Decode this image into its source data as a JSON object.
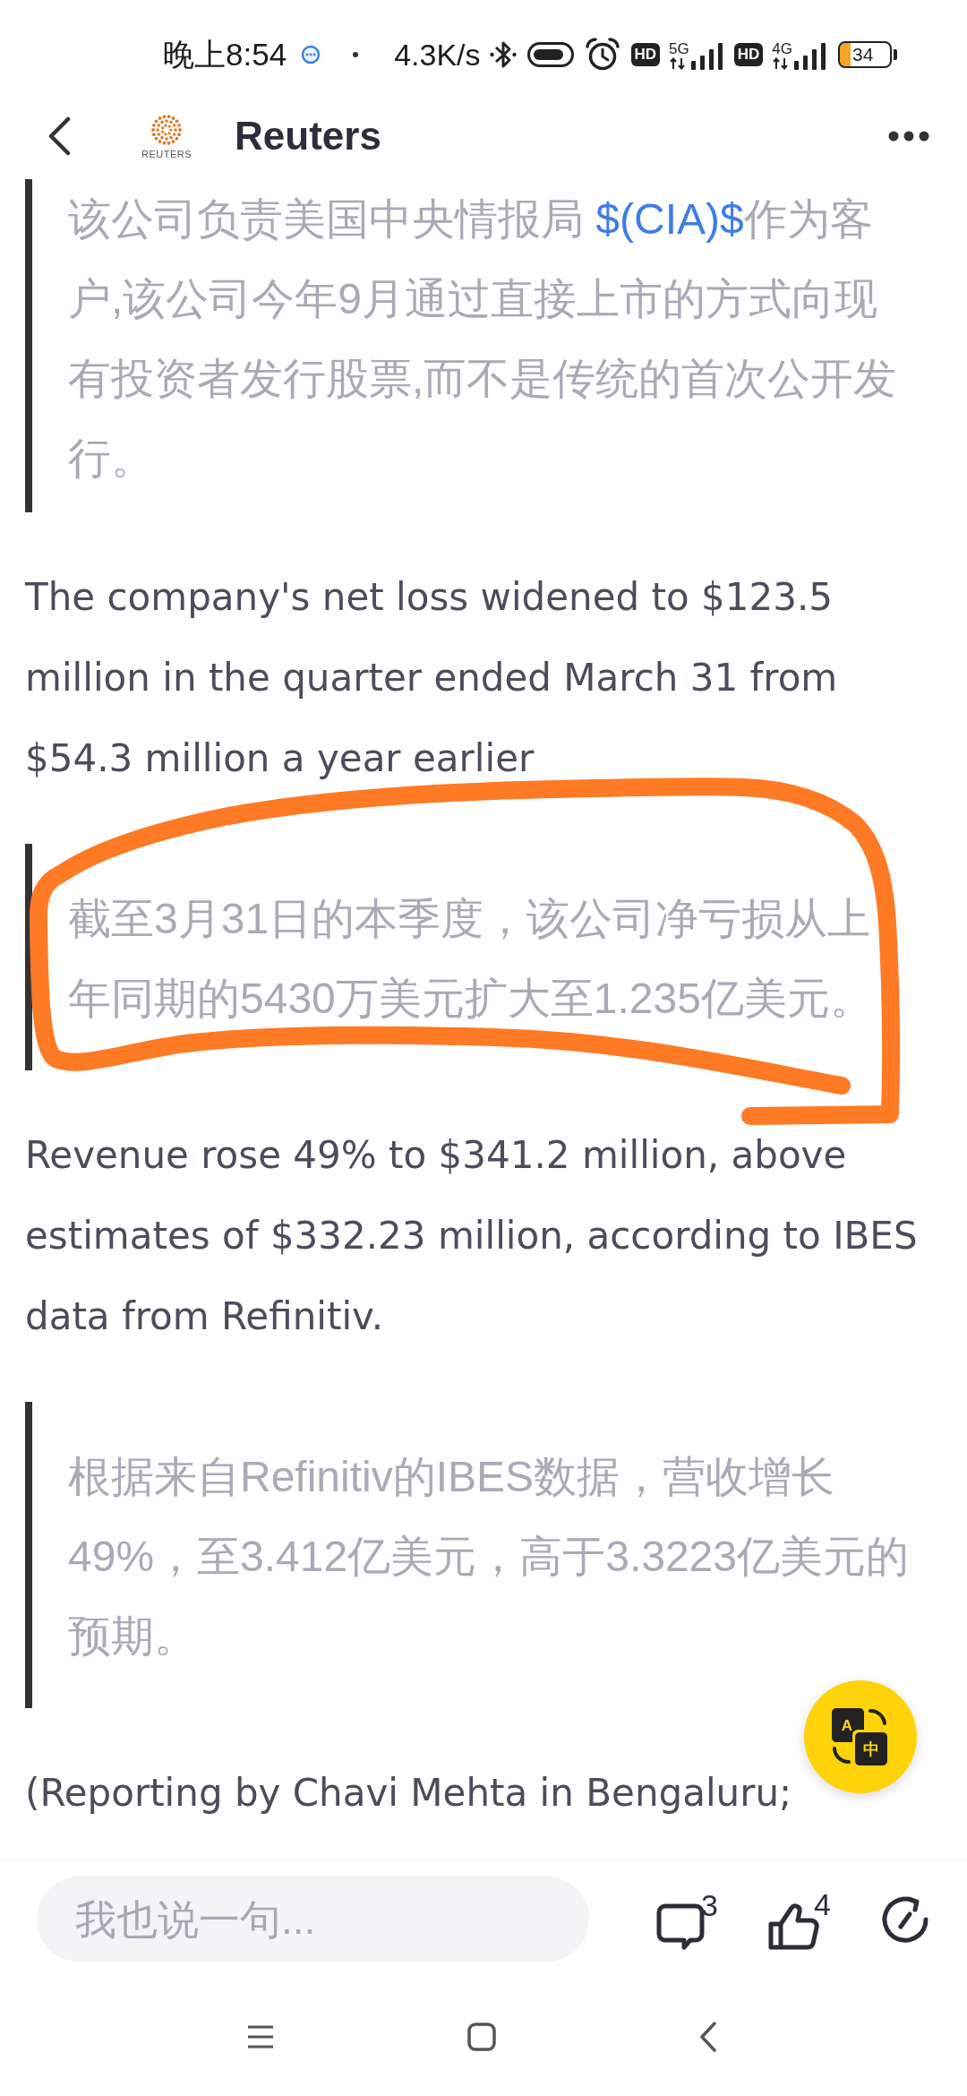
{
  "status_bar": {
    "time": "晚上8:54",
    "net_speed": "4.3K/s",
    "sims": [
      {
        "hd": "HD",
        "network": "5G"
      },
      {
        "hd": "HD",
        "network": "4G"
      }
    ],
    "battery": "34"
  },
  "header": {
    "logo_text": "REUTERS",
    "title": "Reuters"
  },
  "article": [
    {
      "kind": "quote",
      "segments": [
        {
          "kind": "text",
          "text": "该公司负责美国中央情报局 "
        },
        {
          "kind": "link",
          "text": "$(CIA)$"
        },
        {
          "kind": "text",
          "text": "作为客户,该公司今年9月通过直接上市的方式向现有投资者发行股票,而不是传统的首次公开发行。"
        }
      ]
    },
    {
      "kind": "paragraph",
      "segments": [
        {
          "kind": "text",
          "text": "The company's net loss widened to $123.5 million in the quarter ended March 31 from $54.3 million a year earlier"
        }
      ]
    },
    {
      "kind": "quote",
      "segments": [
        {
          "kind": "text",
          "text": "截至3月31日的本季度，该公司净亏损从上年同期的5430万美元扩大至1.235亿美元。"
        }
      ]
    },
    {
      "kind": "paragraph",
      "segments": [
        {
          "kind": "text",
          "text": "Revenue rose 49% to $341.2 million, above estimates of $332.23 million, according to IBES data from Refinitiv."
        }
      ]
    },
    {
      "kind": "quote",
      "segments": [
        {
          "kind": "text",
          "text": "根据来自Refinitiv的IBES数据，营收增长49%，至3.412亿美元，高于3.3223亿美元的预期。"
        }
      ]
    },
    {
      "kind": "paragraph",
      "segments": [
        {
          "kind": "text",
          "text": "(Reporting by Chavi Mehta in Bengaluru;"
        }
      ]
    }
  ],
  "translate_button": {
    "source": "A",
    "target": "中"
  },
  "comment_bar": {
    "placeholder": "我也说一句...",
    "comments": "3",
    "likes": "4"
  }
}
